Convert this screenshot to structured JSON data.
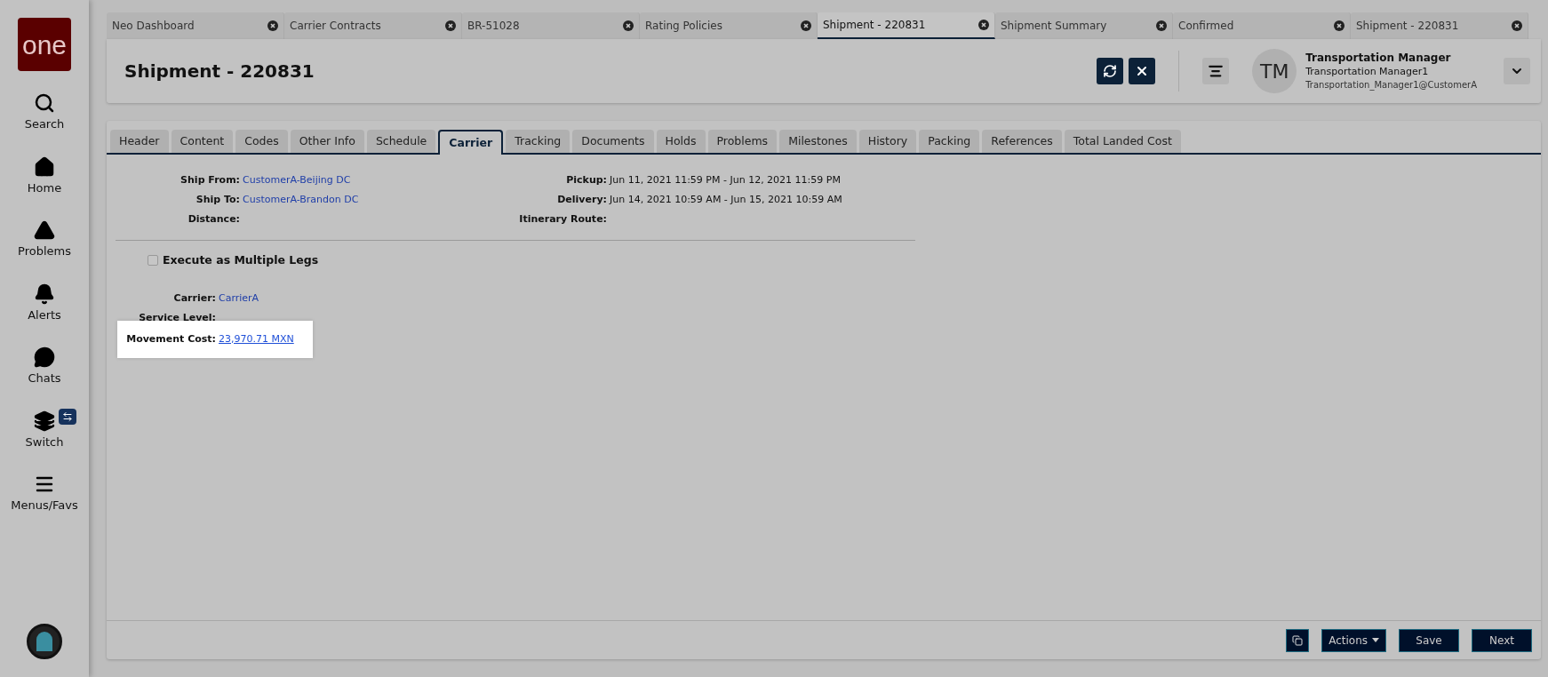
{
  "sidebar": {
    "logo": "one",
    "items": [
      {
        "kind": "search",
        "label": "Search"
      },
      {
        "kind": "home",
        "label": "Home"
      },
      {
        "kind": "problems",
        "label": "Problems"
      },
      {
        "kind": "alerts",
        "label": "Alerts"
      },
      {
        "kind": "chats",
        "label": "Chats"
      },
      {
        "kind": "switch",
        "label": "Switch"
      },
      {
        "kind": "menu",
        "label": "Menus/Favs"
      }
    ]
  },
  "open_tabs": [
    {
      "label": "Neo Dashboard",
      "selected": false
    },
    {
      "label": "Carrier Contracts",
      "selected": false
    },
    {
      "label": "BR-51028",
      "selected": false
    },
    {
      "label": "Rating Policies",
      "selected": false
    },
    {
      "label": "Shipment - 220831",
      "selected": true
    },
    {
      "label": "Shipment Summary",
      "selected": false
    },
    {
      "label": "Confirmed",
      "selected": false
    },
    {
      "label": "Shipment - 220831",
      "selected": false
    }
  ],
  "page_title": "Shipment - 220831",
  "user": {
    "initials": "TM",
    "name": "Transportation Manager",
    "username": "Transportation Manager1",
    "login": "Transportation_Manager1@CustomerA"
  },
  "tabs": [
    {
      "label": "Header",
      "selected": false
    },
    {
      "label": "Content",
      "selected": false
    },
    {
      "label": "Codes",
      "selected": false
    },
    {
      "label": "Other Info",
      "selected": false
    },
    {
      "label": "Schedule",
      "selected": false
    },
    {
      "label": "Carrier",
      "selected": true
    },
    {
      "label": "Tracking",
      "selected": false
    },
    {
      "label": "Documents",
      "selected": false
    },
    {
      "label": "Holds",
      "selected": false
    },
    {
      "label": "Problems",
      "selected": false
    },
    {
      "label": "Milestones",
      "selected": false
    },
    {
      "label": "History",
      "selected": false
    },
    {
      "label": "Packing",
      "selected": false
    },
    {
      "label": "References",
      "selected": false
    },
    {
      "label": "Total Landed Cost",
      "selected": false
    }
  ],
  "route_fields": {
    "left": [
      {
        "label": "Ship From:",
        "value": "CustomerA-Beijing DC",
        "kind": "link"
      },
      {
        "label": "Ship To:",
        "value": "CustomerA-Brandon DC",
        "kind": "link"
      },
      {
        "label": "Distance:"
      }
    ],
    "right": [
      {
        "label": "Pickup:",
        "value": "Jun 11, 2021 11:59 PM - Jun 12, 2021 11:59 PM"
      },
      {
        "label": "Delivery:",
        "value": "Jun 14, 2021 10:59 AM - Jun 15, 2021 10:59 AM"
      },
      {
        "label": "Itinerary Route:"
      }
    ]
  },
  "multiple_legs": {
    "label": "Execute as Multiple Legs",
    "checked": false
  },
  "carrier_fields": [
    {
      "label": "Carrier:",
      "value": "CarrierA",
      "kind": "link",
      "highlighted": false
    },
    {
      "label": "Service Level:",
      "highlighted": false
    },
    {
      "label": "Movement Cost:",
      "value": "23,970.71 MXN",
      "kind": "underlined-link",
      "highlighted": true
    }
  ],
  "footer": {
    "actions": "Actions",
    "buttons": [
      "Save",
      "Next"
    ]
  }
}
